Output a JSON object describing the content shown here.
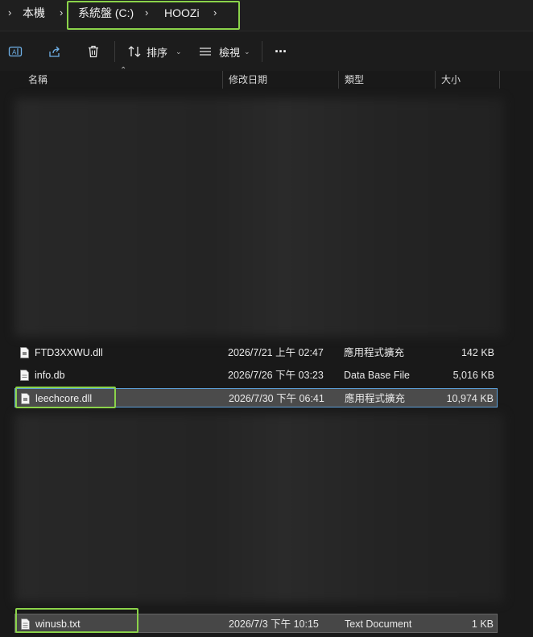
{
  "address_bar": {
    "crumbs": [
      "本機",
      "系統盤 (C:)",
      "HOOZi"
    ]
  },
  "toolbar": {
    "sort_label": "排序",
    "view_label": "檢視",
    "more_label": "···"
  },
  "columns": {
    "name": "名稱",
    "date": "修改日期",
    "type": "類型",
    "size": "大小"
  },
  "files": [
    {
      "name": "FTD3XXWU.dll",
      "date": "2026/7/21 上午 02:47",
      "type": "應用程式擴充",
      "size": "142 KB"
    },
    {
      "name": "info.db",
      "date": "2026/7/26 下午 03:23",
      "type": "Data Base File",
      "size": "5,016 KB"
    },
    {
      "name": "leechcore.dll",
      "date": "2026/7/30 下午 06:41",
      "type": "應用程式擴充",
      "size": "10,974 KB"
    },
    {
      "name": "winusb.txt",
      "date": "2026/7/3 下午 10:15",
      "type": "Text Document",
      "size": "1 KB"
    }
  ],
  "colors": {
    "highlight": "#8bd34a",
    "selection_border": "#5da0d8",
    "background": "#191919"
  }
}
